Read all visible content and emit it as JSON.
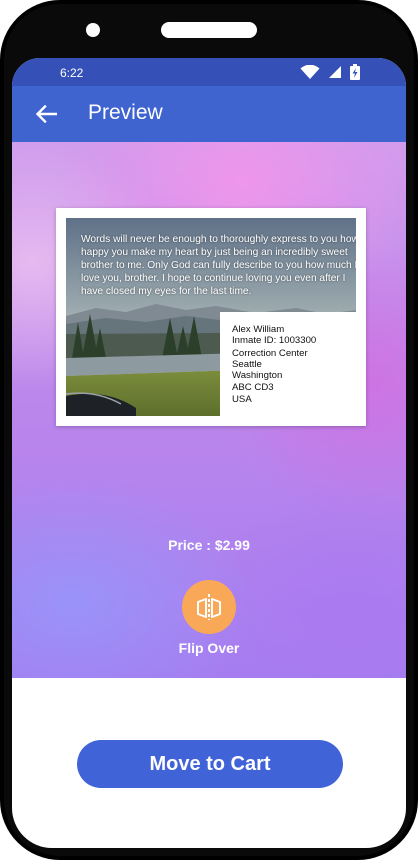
{
  "status_bar": {
    "time": "6:22",
    "icons": [
      "wifi-icon",
      "signal-icon",
      "battery-charging-icon"
    ]
  },
  "app_bar": {
    "back_icon": "arrow-left-icon",
    "title": "Preview"
  },
  "postcard": {
    "message": "Words will never be enough to thoroughly express to you how happy you make my heart by just being an incredibly sweet brother to me. Only God can fully describe to you how much I love you, brother. I hope to continue loving you even after I have closed my eyes for the last time.",
    "recipient": {
      "name": "Alex William",
      "inmate_id": "Inmate ID: 1003300",
      "facility": "Correction Center",
      "city": "Seattle",
      "state": "Washington",
      "postal": "ABC CD3",
      "country": "USA"
    }
  },
  "price": "Price : $2.99",
  "flip": {
    "icon": "flip-horizontal-icon",
    "label": "Flip Over"
  },
  "cart_button": {
    "label": "Move to Cart"
  },
  "colors": {
    "status_bar": "#3551b8",
    "app_bar": "#3f63cf",
    "accent_orange": "#f9a858",
    "cart_button": "#4063d8"
  }
}
